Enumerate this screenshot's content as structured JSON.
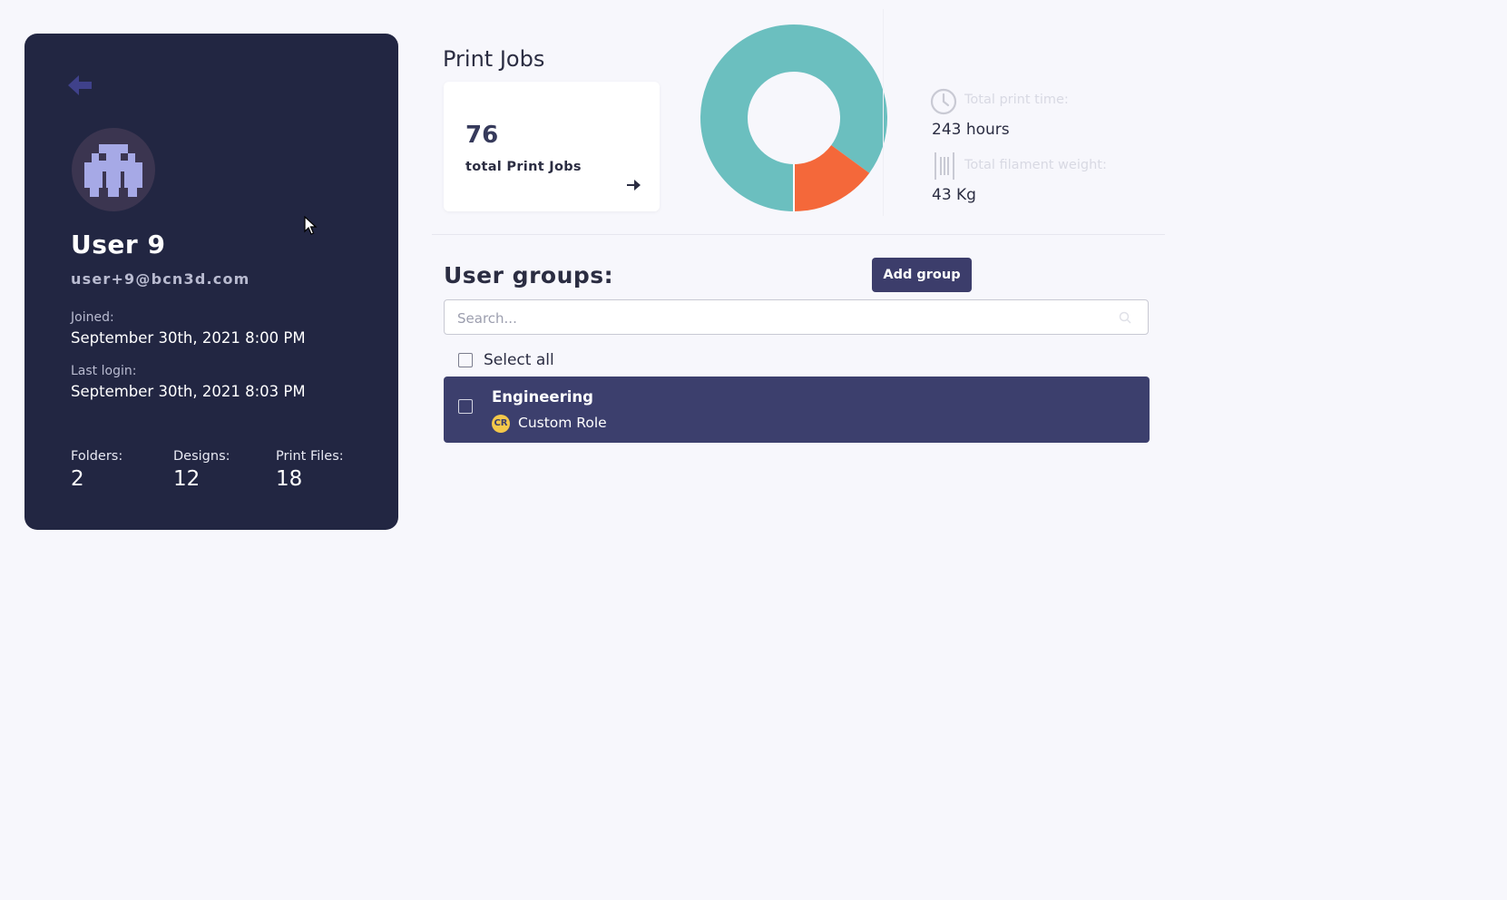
{
  "profile": {
    "name": "User 9",
    "email": "user+9@bcn3d.com",
    "joined_label": "Joined:",
    "joined_value": "September 30th, 2021 8:00 PM",
    "last_login_label": "Last login:",
    "last_login_value": "September 30th, 2021 8:03 PM",
    "stats": [
      {
        "label": "Folders:",
        "value": "2"
      },
      {
        "label": "Designs:",
        "value": "12"
      },
      {
        "label": "Print Files:",
        "value": "18"
      }
    ]
  },
  "print_jobs": {
    "title": "Print Jobs",
    "count": "76",
    "count_label": "total Print Jobs",
    "donut": {
      "segments": [
        {
          "value": 0.85,
          "color": "#6bbfbf"
        },
        {
          "value": 0.15,
          "color": "#f4683a"
        }
      ]
    },
    "total_print_time_label": "Total print time:",
    "total_print_time_value": "243 hours",
    "filament_label": "Total filament weight:",
    "filament_value": "43 Kg"
  },
  "groups": {
    "title": "User groups:",
    "add_button": "Add group",
    "search_placeholder": "Search...",
    "select_all": "Select all",
    "items": [
      {
        "name": "Engineering",
        "role_badge": "CR",
        "role": "Custom Role"
      }
    ]
  },
  "colors": {
    "sidebar_bg": "#222642",
    "accent": "#3c3d6b",
    "donut_primary": "#6bbfbf",
    "donut_secondary": "#f4683a",
    "role_badge": "#f4c84a"
  }
}
